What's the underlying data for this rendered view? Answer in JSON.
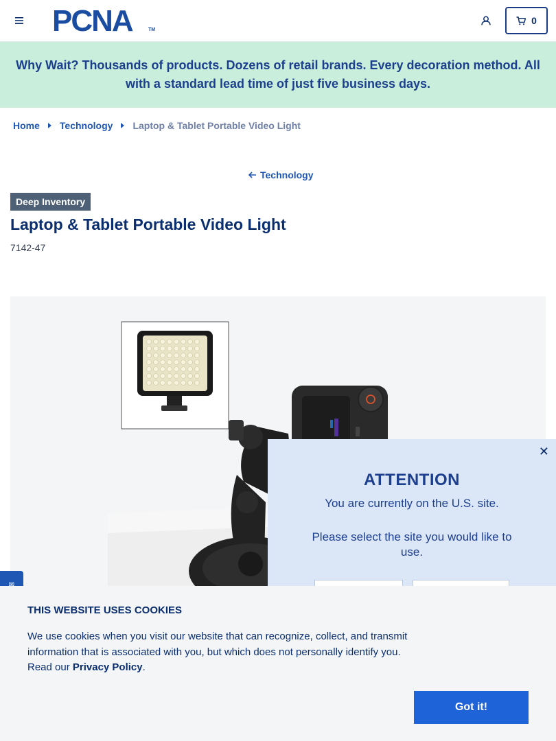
{
  "header": {
    "logo_text": "PCNA",
    "logo_tm": "TM",
    "cart_count": "0"
  },
  "promo": {
    "text": "Why Wait? Thousands of products. Dozens of retail brands. Every decoration method. All with a standard lead time of just five business days."
  },
  "breadcrumb": {
    "home": "Home",
    "category": "Technology",
    "current": "Laptop & Tablet Portable Video Light"
  },
  "back_link": "Technology",
  "product": {
    "badge": "Deep Inventory",
    "title": "Laptop & Tablet Portable Video Light",
    "sku": "7142-47"
  },
  "region_modal": {
    "title": "ATTENTION",
    "message": "You are currently on the U.S. site.",
    "prompt": "Please select the site you would like to use.",
    "close_glyph": "✕"
  },
  "cookie": {
    "title": "THIS WEBSITE USES COOKIES",
    "text_before": "We use cookies when you visit our website that can recognize, collect, and transmit information that is associated with you, but which does not personally identify you. Read our ",
    "policy_link": "Privacy Policy",
    "text_after": ".",
    "button": "Got it!"
  },
  "colors": {
    "brand_blue": "#1a4da1",
    "link_blue": "#1f57b5",
    "promo_bg": "#c9eedb",
    "modal_bg": "#dbe6f6",
    "button_blue": "#1f63d8"
  },
  "icons": {
    "menu": "hamburger-menu-icon",
    "account": "user-icon",
    "cart": "cart-icon",
    "back": "arrow-left-icon"
  }
}
